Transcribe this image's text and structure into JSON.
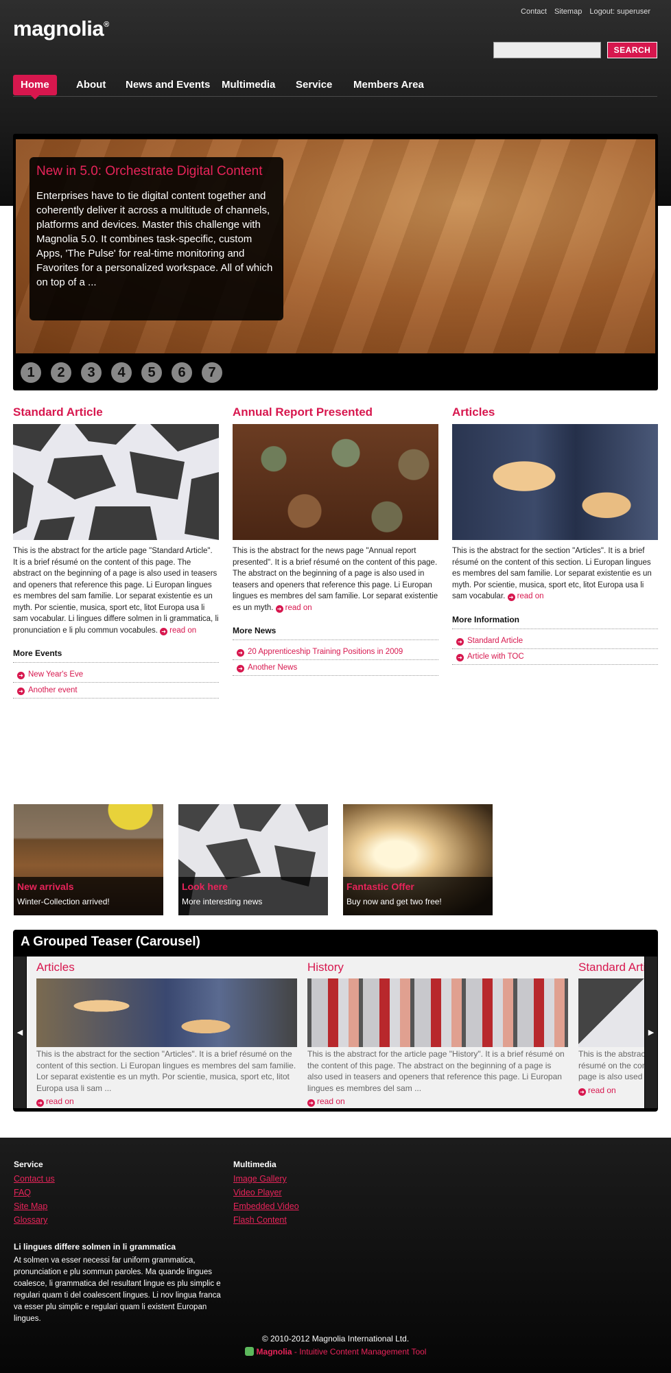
{
  "header": {
    "logo": "magnolia",
    "logo_mark": "®",
    "top_links": [
      "Contact",
      "Sitemap",
      "Logout: superuser"
    ],
    "search_placeholder": "",
    "search_button": "SEARCH"
  },
  "nav": {
    "items": [
      "Home",
      "About",
      "News and Events",
      "Multimedia",
      "Service",
      "Members Area"
    ],
    "active": "Home"
  },
  "stage": {
    "title": "New in 5.0: Orchestrate Digital Content",
    "text": "Enterprises have to tie digital content together and coherently deliver it across a multitude of channels, platforms and devices. Master this challenge with Magnolia 5.0. It combines task-specific, custom Apps, 'The Pulse' for real-time monitoring and Favorites for a personalized workspace. All of which on top of a ...",
    "pages": [
      "1",
      "2",
      "3",
      "4",
      "5",
      "6",
      "7"
    ]
  },
  "columns": [
    {
      "title": "Standard Article",
      "abstract": "This is the abstract for the article page \"Standard Article\". It is a brief résumé on the content of this page. The abstract on the beginning of a page is also used in teasers and openers that reference this page. Li Europan lingues es membres del sam familie. Lor separat existentie es un myth. Por scientie, musica, sport etc, litot Europa usa li sam vocabular. Li lingues differe solmen in li grammatica, li pronunciation e li plu commun vocabules.",
      "read_on": "read on",
      "more_title": "More Events",
      "more_items": [
        "New Year's Eve",
        "Another event"
      ]
    },
    {
      "title": "Annual Report Presented",
      "abstract": "This is the abstract for the news page \"Annual report presented\". It is a brief résumé on the content of this page. The abstract on the beginning of a page is also used in teasers and openers that reference this page. Li Europan lingues es membres del sam familie. Lor separat existentie es un myth.",
      "read_on": "read on",
      "more_title": "More News",
      "more_items": [
        "20 Apprenticeship Training Positions in 2009",
        "Another News"
      ]
    },
    {
      "title": "Articles",
      "abstract": "This is the abstract for the section \"Articles\". It is a brief résumé on the content of this section. Li Europan lingues es membres del sam familie. Lor separat existentie es un myth. Por scientie, musica, sport etc, litot Europa usa li sam vocabular.",
      "read_on": "read on",
      "more_title": "More Information",
      "more_items": [
        "Standard Article",
        "Article with TOC"
      ]
    }
  ],
  "teasers": [
    {
      "title": "New arrivals",
      "subtitle": "Winter-Collection arrived!"
    },
    {
      "title": "Look here",
      "subtitle": "More interesting news"
    },
    {
      "title": "Fantastic Offer",
      "subtitle": "Buy now and get two free!"
    }
  ],
  "carousel": {
    "title": "A Grouped Teaser (Carousel)",
    "items": [
      {
        "title": "Articles",
        "abstract": "This is the abstract for the section \"Articles\". It is a brief résumé on the content of this section. Li Europan lingues es membres del sam familie. Lor separat existentie es un myth. Por scientie, musica, sport etc, litot Europa usa li sam ...",
        "read_on": "read on"
      },
      {
        "title": "History",
        "abstract": "This is the abstract for the article page \"History\". It is a brief résumé on the content of this page. The abstract on the beginning of a page is also used in teasers and openers that reference this page. Li Europan lingues es membres del sam ...",
        "read_on": "read on"
      },
      {
        "title": "Standard Article",
        "abstract": "This is the abstract for the article page \"Standard Article\". It is a brief résumé on the content of this page. The abstract on the beginning of a page is also used in teasers and openers that reference this page.",
        "read_on": "read on"
      }
    ]
  },
  "footer": {
    "service_title": "Service",
    "service_links": [
      "Contact us",
      "FAQ",
      "Site Map",
      "Glossary"
    ],
    "multimedia_title": "Multimedia",
    "multimedia_links": [
      "Image Gallery",
      "Video Player",
      "Embedded Video",
      "Flash Content"
    ],
    "block_title": "Li lingues differe solmen in li grammatica",
    "block_text": "At solmen va esser necessi far uniform grammatica, pronunciation e plu sommun paroles. Ma quande lingues coalesce, li grammatica del resultant lingue es plu simplic e regulari quam ti del coalescent lingues. Li nov lingua franca va esser plu simplic e regulari quam li existent Europan lingues.",
    "copyright": "© 2010-2012 Magnolia International Ltd.",
    "powered_brand": "Magnolia",
    "powered_text": " - Intuitive Content Management Tool"
  },
  "colors": {
    "accent": "#d7174e",
    "header_bg": "#1b1b1b"
  }
}
